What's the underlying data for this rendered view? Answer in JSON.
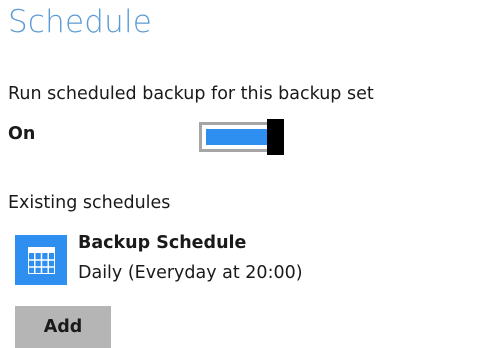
{
  "page": {
    "title": "Schedule"
  },
  "scheduled_backup": {
    "label": "Run scheduled backup for this backup set",
    "state_label": "On",
    "enabled": true
  },
  "existing": {
    "label": "Existing schedules",
    "items": [
      {
        "name": "Backup Schedule",
        "detail": "Daily (Everyday at 20:00)",
        "icon": "calendar-icon"
      }
    ]
  },
  "actions": {
    "add_label": "Add"
  },
  "colors": {
    "title": "#5b9bd5",
    "accent": "#2f8ff0",
    "toggle_thumb": "#000000",
    "button_bg": "#b5b5b5"
  }
}
